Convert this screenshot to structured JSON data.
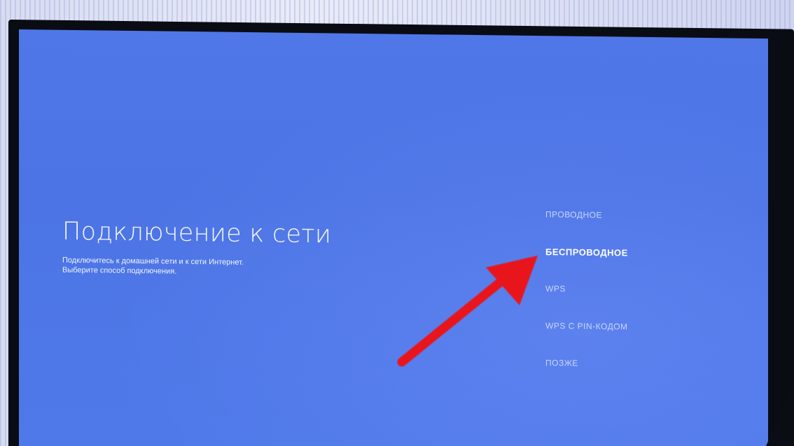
{
  "setup": {
    "title": "Подключение к сети",
    "description_line1": "Подключитесь к домашней сети и к сети Интернет.",
    "description_line2": "Выберите способ подключения."
  },
  "options": [
    {
      "label": "ПРОВОДНОЕ",
      "focused": false
    },
    {
      "label": "БЕСПРОВОДНОЕ",
      "focused": true
    },
    {
      "label": "WPS",
      "focused": false
    },
    {
      "label": "WPS С PIN-КОДОМ",
      "focused": false
    },
    {
      "label": "ПОЗЖЕ",
      "focused": false
    }
  ],
  "colors": {
    "screen_blue": "#4f77e8",
    "arrow_red": "#e8141c",
    "option_text": "#c9d6ff",
    "focused_text": "#ffffff"
  },
  "icons": {
    "annotation_arrow": "red-arrow-icon"
  }
}
